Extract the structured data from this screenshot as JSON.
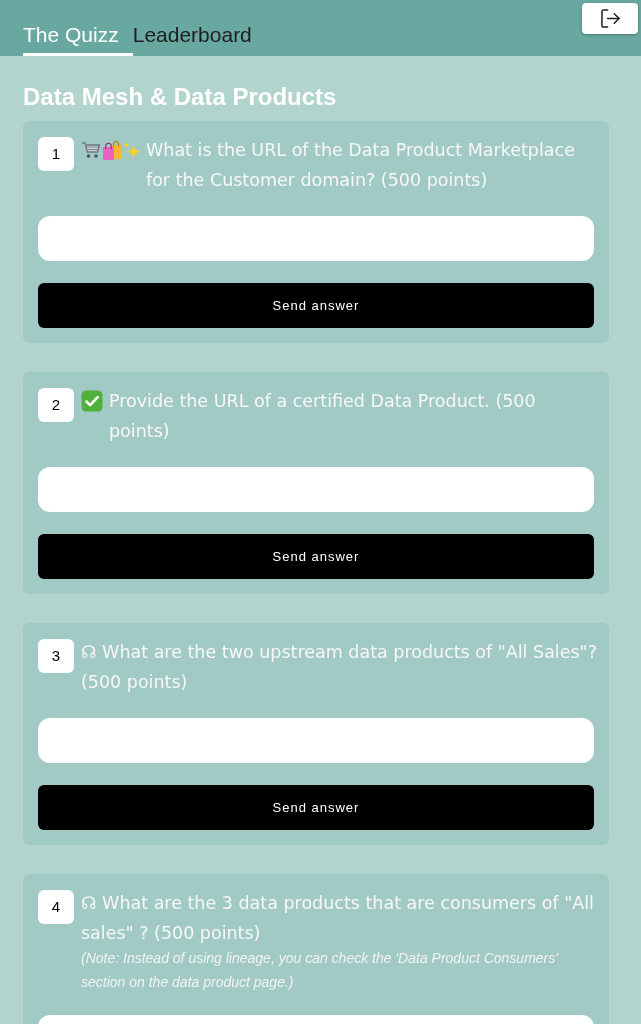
{
  "header": {
    "tabs": [
      {
        "label": "The Quizz",
        "selected": true
      },
      {
        "label": "Leaderboard",
        "selected": false
      }
    ]
  },
  "page_title": "Data Mesh & Data Products",
  "questions": [
    {
      "number": "1",
      "icons": [
        {
          "kind": "cart"
        },
        {
          "kind": "bags"
        },
        {
          "kind": "sparkles"
        }
      ],
      "text": "What is the URL of the Data Product Marketplace for the Customer domain? (500 points)",
      "button": "Send answer"
    },
    {
      "number": "2",
      "icons": [
        {
          "kind": "check"
        }
      ],
      "text": "Provide the URL of a certified Data Product. (500 points)",
      "button": "Send answer"
    },
    {
      "number": "3",
      "text": "☊ What are the two upstream data products of \"All Sales\"? (500 points)",
      "button": "Send answer"
    },
    {
      "number": "4",
      "text": "☊ What are the 3 data products that are consumers of \"All sales\" ? (500 points)",
      "note": "(Note: Instead of using lineage, you can check the 'Data Product Consumers' section on the data product page.)"
    }
  ]
}
